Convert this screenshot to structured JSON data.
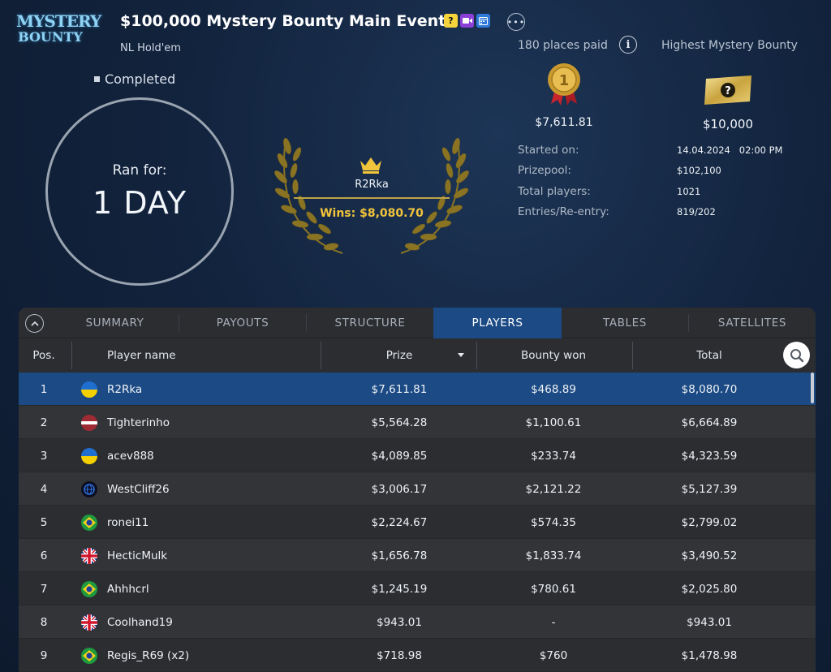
{
  "logo": {
    "line1": "MYSTERY",
    "line2": "BOUNTY"
  },
  "tournament": {
    "title": "$100,000 Mystery Bounty Main Event",
    "game": "NL Hold'em",
    "status": "Completed",
    "badge_icons": [
      "mystery-bounty-icon",
      "video-icon",
      "calendar-icon"
    ],
    "badge_colors": [
      "#f5d33b",
      "#8b3fd6",
      "#2f7ad9"
    ]
  },
  "duration": {
    "label": "Ran for:",
    "value": "1 DAY"
  },
  "winner": {
    "name": "R2Rka",
    "wins": "Wins: $8,080.70"
  },
  "summary": {
    "places_paid": "180 places paid",
    "highest_bounty_label": "Highest Mystery Bounty",
    "medal_number": "1",
    "first_prize": "$7,611.81",
    "ticket_symbol": "?",
    "highest_bounty": "$10,000",
    "stats": [
      {
        "label": "Started on:",
        "value": "14.04.2024   02:00 PM"
      },
      {
        "label": "Prizepool:",
        "value": "$102,100"
      },
      {
        "label": "Total players:",
        "value": "1021"
      },
      {
        "label": "Entries/Re-entry:",
        "value": "819/202"
      }
    ]
  },
  "tabs": [
    "SUMMARY",
    "PAYOUTS",
    "STRUCTURE",
    "PLAYERS",
    "TABLES",
    "SATELLITES"
  ],
  "active_tab": "PLAYERS",
  "columns": {
    "pos": "Pos.",
    "name": "Player name",
    "prize": "Prize",
    "bounty": "Bounty won",
    "total": "Total"
  },
  "rows": [
    {
      "pos": "1",
      "flag": "ukraine",
      "name": "R2Rka",
      "prize": "$7,611.81",
      "bounty": "$468.89",
      "total": "$8,080.70"
    },
    {
      "pos": "2",
      "flag": "latvia",
      "name": "Tighterinho",
      "prize": "$5,564.28",
      "bounty": "$1,100.61",
      "total": "$6,664.89"
    },
    {
      "pos": "3",
      "flag": "ukraine",
      "name": "acev888",
      "prize": "$4,089.85",
      "bounty": "$233.74",
      "total": "$4,323.59"
    },
    {
      "pos": "4",
      "flag": "world",
      "name": "WestCliff26",
      "prize": "$3,006.17",
      "bounty": "$2,121.22",
      "total": "$5,127.39"
    },
    {
      "pos": "5",
      "flag": "brazil",
      "name": "ronei11",
      "prize": "$2,224.67",
      "bounty": "$574.35",
      "total": "$2,799.02"
    },
    {
      "pos": "6",
      "flag": "uk",
      "name": "HecticMulk",
      "prize": "$1,656.78",
      "bounty": "$1,833.74",
      "total": "$3,490.52"
    },
    {
      "pos": "7",
      "flag": "brazil",
      "name": "Ahhhcrl",
      "prize": "$1,245.19",
      "bounty": "$780.61",
      "total": "$2,025.80"
    },
    {
      "pos": "8",
      "flag": "uk",
      "name": "Coolhand19",
      "prize": "$943.01",
      "bounty": "-",
      "total": "$943.01"
    },
    {
      "pos": "9",
      "flag": "brazil",
      "name": "Regis_R69 (x2)",
      "prize": "$718.98",
      "bounty": "$760",
      "total": "$1,478.98"
    }
  ],
  "colors": {
    "accent": "#1c4a84",
    "gold": "#f2c43b",
    "panel": "#2b2d31"
  }
}
